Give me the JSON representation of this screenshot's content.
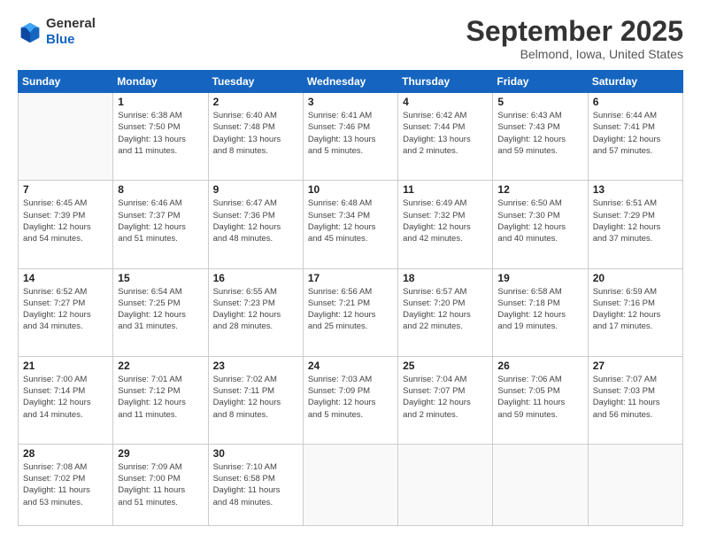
{
  "logo": {
    "general": "General",
    "blue": "Blue"
  },
  "header": {
    "month": "September 2025",
    "location": "Belmond, Iowa, United States"
  },
  "weekdays": [
    "Sunday",
    "Monday",
    "Tuesday",
    "Wednesday",
    "Thursday",
    "Friday",
    "Saturday"
  ],
  "weeks": [
    [
      {
        "day": "",
        "info": ""
      },
      {
        "day": "1",
        "info": "Sunrise: 6:38 AM\nSunset: 7:50 PM\nDaylight: 13 hours\nand 11 minutes."
      },
      {
        "day": "2",
        "info": "Sunrise: 6:40 AM\nSunset: 7:48 PM\nDaylight: 13 hours\nand 8 minutes."
      },
      {
        "day": "3",
        "info": "Sunrise: 6:41 AM\nSunset: 7:46 PM\nDaylight: 13 hours\nand 5 minutes."
      },
      {
        "day": "4",
        "info": "Sunrise: 6:42 AM\nSunset: 7:44 PM\nDaylight: 13 hours\nand 2 minutes."
      },
      {
        "day": "5",
        "info": "Sunrise: 6:43 AM\nSunset: 7:43 PM\nDaylight: 12 hours\nand 59 minutes."
      },
      {
        "day": "6",
        "info": "Sunrise: 6:44 AM\nSunset: 7:41 PM\nDaylight: 12 hours\nand 57 minutes."
      }
    ],
    [
      {
        "day": "7",
        "info": "Sunrise: 6:45 AM\nSunset: 7:39 PM\nDaylight: 12 hours\nand 54 minutes."
      },
      {
        "day": "8",
        "info": "Sunrise: 6:46 AM\nSunset: 7:37 PM\nDaylight: 12 hours\nand 51 minutes."
      },
      {
        "day": "9",
        "info": "Sunrise: 6:47 AM\nSunset: 7:36 PM\nDaylight: 12 hours\nand 48 minutes."
      },
      {
        "day": "10",
        "info": "Sunrise: 6:48 AM\nSunset: 7:34 PM\nDaylight: 12 hours\nand 45 minutes."
      },
      {
        "day": "11",
        "info": "Sunrise: 6:49 AM\nSunset: 7:32 PM\nDaylight: 12 hours\nand 42 minutes."
      },
      {
        "day": "12",
        "info": "Sunrise: 6:50 AM\nSunset: 7:30 PM\nDaylight: 12 hours\nand 40 minutes."
      },
      {
        "day": "13",
        "info": "Sunrise: 6:51 AM\nSunset: 7:29 PM\nDaylight: 12 hours\nand 37 minutes."
      }
    ],
    [
      {
        "day": "14",
        "info": "Sunrise: 6:52 AM\nSunset: 7:27 PM\nDaylight: 12 hours\nand 34 minutes."
      },
      {
        "day": "15",
        "info": "Sunrise: 6:54 AM\nSunset: 7:25 PM\nDaylight: 12 hours\nand 31 minutes."
      },
      {
        "day": "16",
        "info": "Sunrise: 6:55 AM\nSunset: 7:23 PM\nDaylight: 12 hours\nand 28 minutes."
      },
      {
        "day": "17",
        "info": "Sunrise: 6:56 AM\nSunset: 7:21 PM\nDaylight: 12 hours\nand 25 minutes."
      },
      {
        "day": "18",
        "info": "Sunrise: 6:57 AM\nSunset: 7:20 PM\nDaylight: 12 hours\nand 22 minutes."
      },
      {
        "day": "19",
        "info": "Sunrise: 6:58 AM\nSunset: 7:18 PM\nDaylight: 12 hours\nand 19 minutes."
      },
      {
        "day": "20",
        "info": "Sunrise: 6:59 AM\nSunset: 7:16 PM\nDaylight: 12 hours\nand 17 minutes."
      }
    ],
    [
      {
        "day": "21",
        "info": "Sunrise: 7:00 AM\nSunset: 7:14 PM\nDaylight: 12 hours\nand 14 minutes."
      },
      {
        "day": "22",
        "info": "Sunrise: 7:01 AM\nSunset: 7:12 PM\nDaylight: 12 hours\nand 11 minutes."
      },
      {
        "day": "23",
        "info": "Sunrise: 7:02 AM\nSunset: 7:11 PM\nDaylight: 12 hours\nand 8 minutes."
      },
      {
        "day": "24",
        "info": "Sunrise: 7:03 AM\nSunset: 7:09 PM\nDaylight: 12 hours\nand 5 minutes."
      },
      {
        "day": "25",
        "info": "Sunrise: 7:04 AM\nSunset: 7:07 PM\nDaylight: 12 hours\nand 2 minutes."
      },
      {
        "day": "26",
        "info": "Sunrise: 7:06 AM\nSunset: 7:05 PM\nDaylight: 11 hours\nand 59 minutes."
      },
      {
        "day": "27",
        "info": "Sunrise: 7:07 AM\nSunset: 7:03 PM\nDaylight: 11 hours\nand 56 minutes."
      }
    ],
    [
      {
        "day": "28",
        "info": "Sunrise: 7:08 AM\nSunset: 7:02 PM\nDaylight: 11 hours\nand 53 minutes."
      },
      {
        "day": "29",
        "info": "Sunrise: 7:09 AM\nSunset: 7:00 PM\nDaylight: 11 hours\nand 51 minutes."
      },
      {
        "day": "30",
        "info": "Sunrise: 7:10 AM\nSunset: 6:58 PM\nDaylight: 11 hours\nand 48 minutes."
      },
      {
        "day": "",
        "info": ""
      },
      {
        "day": "",
        "info": ""
      },
      {
        "day": "",
        "info": ""
      },
      {
        "day": "",
        "info": ""
      }
    ]
  ]
}
